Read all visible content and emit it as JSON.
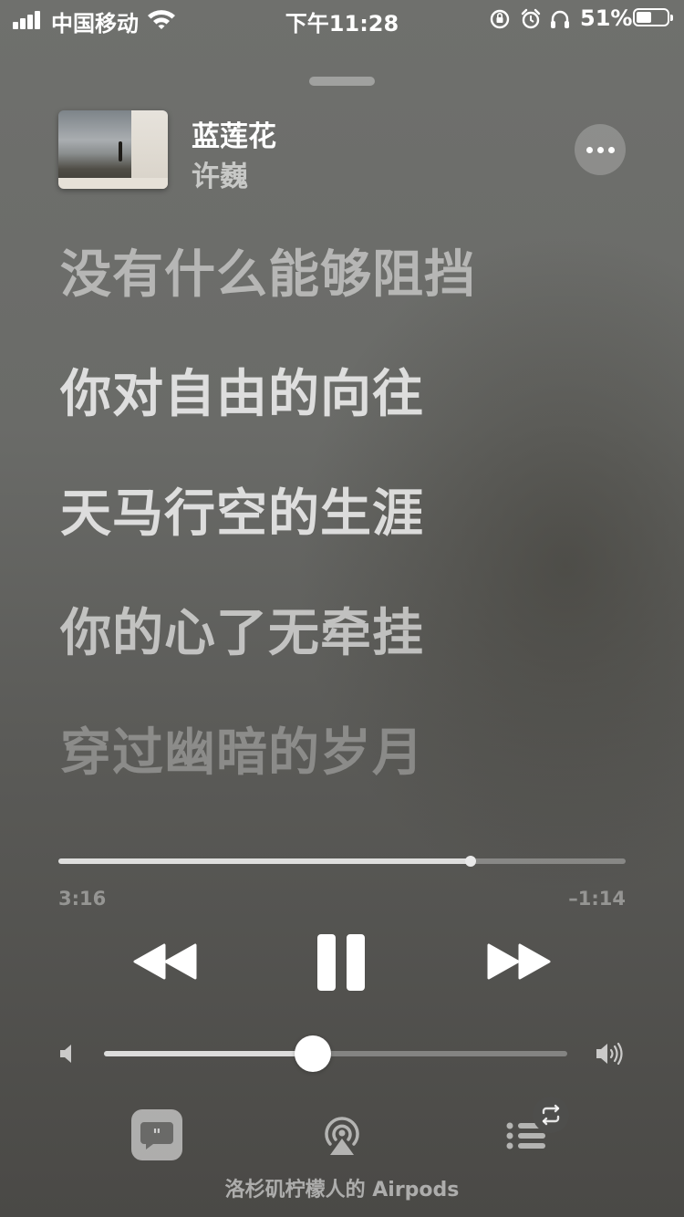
{
  "status_bar": {
    "carrier": "中国移动",
    "time": "下午11:28",
    "battery_percent": "51%",
    "battery_level": 0.51,
    "signal_bars": 4,
    "icons": [
      "signal-icon",
      "wifi-icon",
      "orientation-lock-icon",
      "alarm-icon",
      "headphones-icon",
      "battery-icon"
    ]
  },
  "now_playing": {
    "title": "蓝莲花",
    "artist": "许巍",
    "album_art_icon": "album-art"
  },
  "lyrics": [
    "没有什么能够阻挡",
    "你对自由的向往",
    "天马行空的生涯",
    "你的心了无牵挂",
    "穿过幽暗的岁月"
  ],
  "playback": {
    "elapsed": "3:16",
    "remaining": "–1:14",
    "progress": 0.727,
    "state": "playing"
  },
  "volume": {
    "level": 0.45
  },
  "toolbar": {
    "route_label": "洛杉矶柠檬人的 Airpods",
    "icons": [
      "lyrics-icon",
      "airplay-icon",
      "queue-icon",
      "repeat-icon"
    ]
  },
  "colors": {
    "background": "#6a6b68",
    "accent": "#ffffff"
  }
}
